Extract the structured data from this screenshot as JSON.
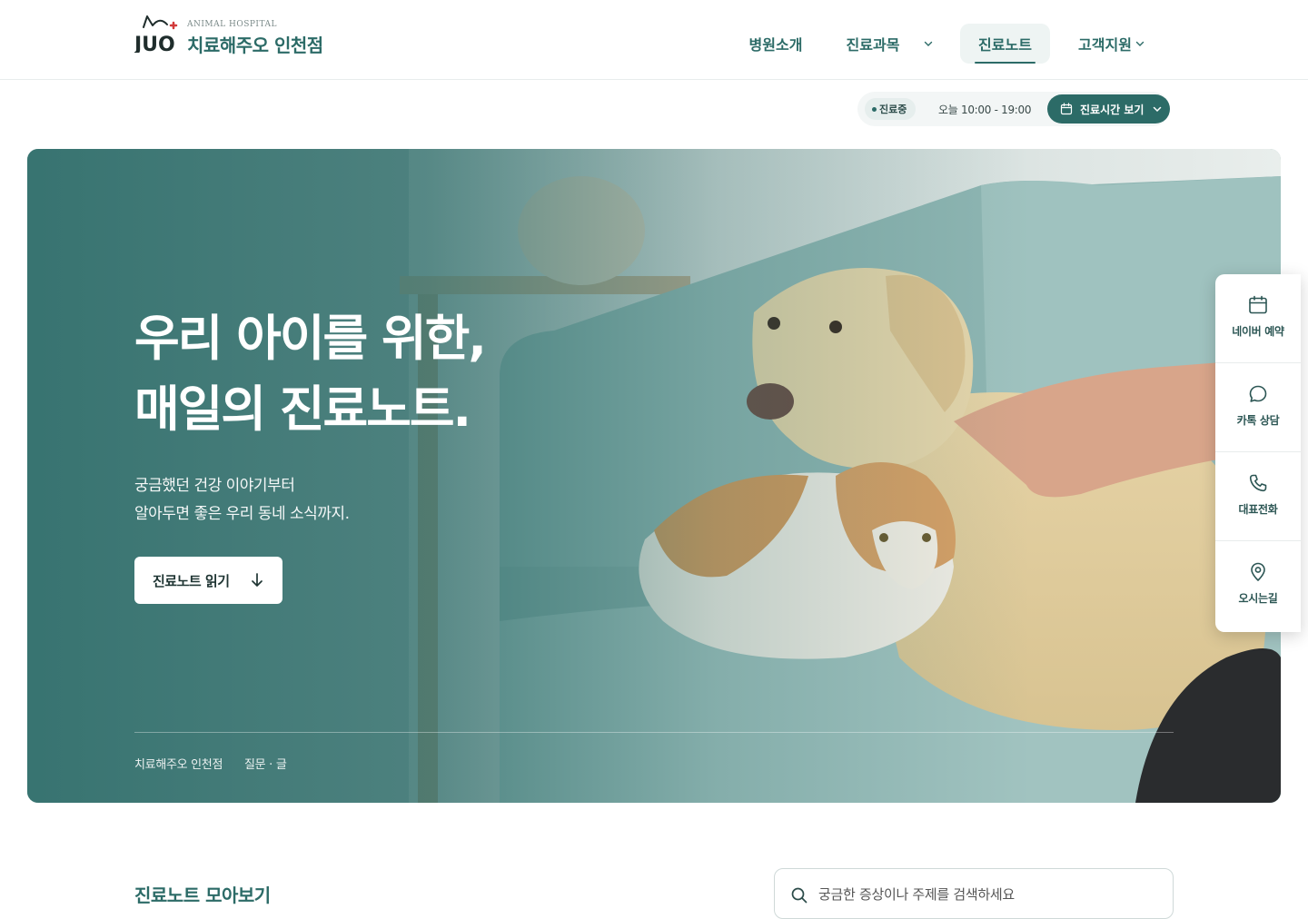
{
  "brand": {
    "logo_mark": "JUO",
    "subtitle": "ANIMAL HOSPITAL",
    "name": "치료해주오 인천점"
  },
  "nav": {
    "items": [
      {
        "label": "병원소개"
      },
      {
        "label": "진료과목"
      },
      {
        "label": "진료노트"
      },
      {
        "label": "고객지원"
      }
    ]
  },
  "status": {
    "live_label": "진료중",
    "hours": "오늘 10:00 - 19:00",
    "hours_button": "진료시간 보기"
  },
  "hero": {
    "title_line1": "우리 아이를 위한,",
    "title_line2": "매일의 진료노트.",
    "sub_line1": "궁금했던 건강 이야기부터",
    "sub_line2": "알아두면 좋은 우리 동네 소식까지.",
    "cta": "진료노트 읽기",
    "meta_branch": "치료해주오 인천점",
    "meta_category": "질문 · 글"
  },
  "quick_menu": [
    {
      "label": "네이버 예약",
      "icon": "calendar-icon"
    },
    {
      "label": "카톡 상담",
      "icon": "chat-bubble-icon"
    },
    {
      "label": "대표전화",
      "icon": "phone-icon"
    },
    {
      "label": "오시는길",
      "icon": "map-pin-icon"
    }
  ],
  "notes": {
    "section_title": "진료노트 모아보기",
    "search_placeholder": "궁금한 증상이나 주제를 검색하세요"
  },
  "colors": {
    "brand": "#2c6b67",
    "accent_red": "#d23a3a",
    "hero_overlay": "#2f6e6b"
  }
}
